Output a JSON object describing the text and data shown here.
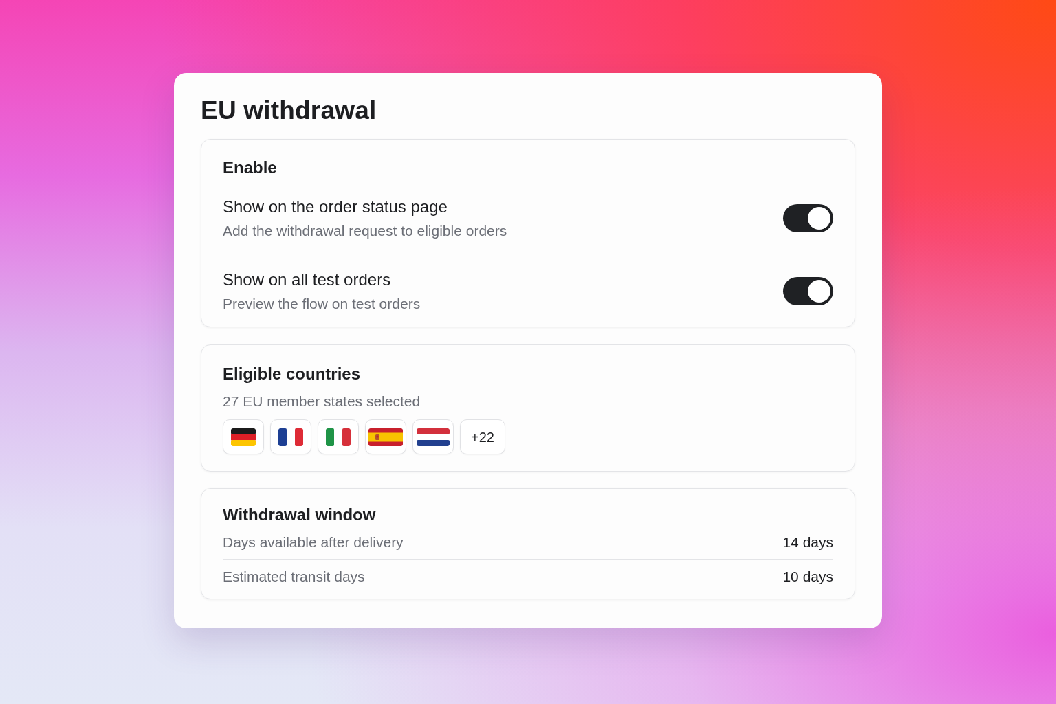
{
  "title": "EU withdrawal",
  "enable": {
    "title": "Enable",
    "toggles": [
      {
        "label": "Show on the order status page",
        "description": "Add the withdrawal request to eligible orders",
        "on": true
      },
      {
        "label": "Show on all test orders",
        "description": "Preview the flow on test orders",
        "on": true
      }
    ]
  },
  "countries": {
    "title": "Eligible countries",
    "summary": "27 EU member states selected",
    "flags": [
      {
        "kind": "germany"
      },
      {
        "kind": "france"
      },
      {
        "kind": "italy"
      },
      {
        "kind": "spain"
      },
      {
        "kind": "netherlands"
      }
    ],
    "more": "+22"
  },
  "window": {
    "title": "Withdrawal window",
    "rows": [
      {
        "label": "Days available after delivery",
        "value": "14 days"
      },
      {
        "label": "Estimated transit days",
        "value": "10 days"
      }
    ]
  }
}
